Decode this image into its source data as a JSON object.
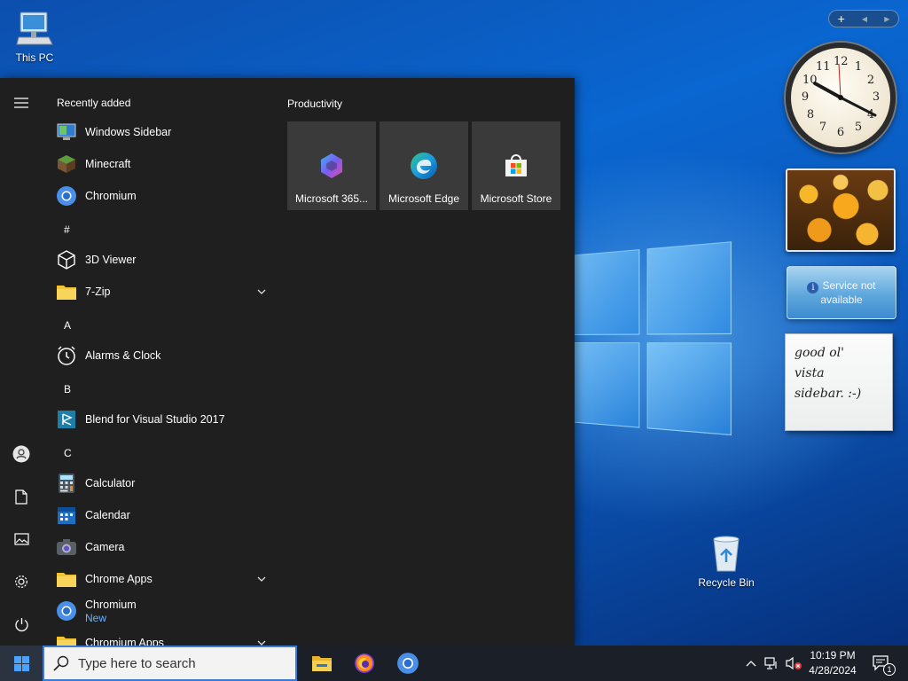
{
  "desktop": {
    "icons": [
      {
        "label": "This PC"
      },
      {
        "label": "Recycle Bin"
      }
    ]
  },
  "gadgets": {
    "toolbar": {
      "add": "+",
      "prev": "◀",
      "next": "▶"
    },
    "clock": {
      "numbers": [
        "12",
        "1",
        "2",
        "3",
        "4",
        "5",
        "6",
        "7",
        "8",
        "9",
        "10",
        "11"
      ]
    },
    "weather": {
      "message": "Service not available"
    },
    "note": {
      "text": "good ol'\nvista\nsidebar. :-)"
    }
  },
  "start_menu": {
    "recently_added_title": "Recently added",
    "productivity_title": "Productivity",
    "apps": [
      {
        "label": "Windows Sidebar"
      },
      {
        "label": "Minecraft"
      },
      {
        "label": "Chromium"
      },
      {
        "letter": "#"
      },
      {
        "label": "3D Viewer"
      },
      {
        "label": "7-Zip"
      },
      {
        "letter": "A"
      },
      {
        "label": "Alarms & Clock"
      },
      {
        "letter": "B"
      },
      {
        "label": "Blend for Visual Studio 2017"
      },
      {
        "letter": "C"
      },
      {
        "label": "Calculator"
      },
      {
        "label": "Calendar"
      },
      {
        "label": "Camera"
      },
      {
        "label": "Chrome Apps"
      },
      {
        "label": "Chromium",
        "sub": "New"
      },
      {
        "label": "Chromium Apps"
      }
    ],
    "tiles": [
      {
        "label": "Microsoft 365..."
      },
      {
        "label": "Microsoft Edge"
      },
      {
        "label": "Microsoft Store"
      }
    ]
  },
  "taskbar": {
    "search_placeholder": "Type here to search",
    "time": "10:19 PM",
    "date": "4/28/2024",
    "notification_count": "1"
  },
  "colors": {
    "accent": "#0078d4",
    "start_bg": "#1f1f1f",
    "taskbar_bg": "#1b1f27",
    "folder_yellow": "#f4c430",
    "new_label": "#6ab4ff"
  }
}
